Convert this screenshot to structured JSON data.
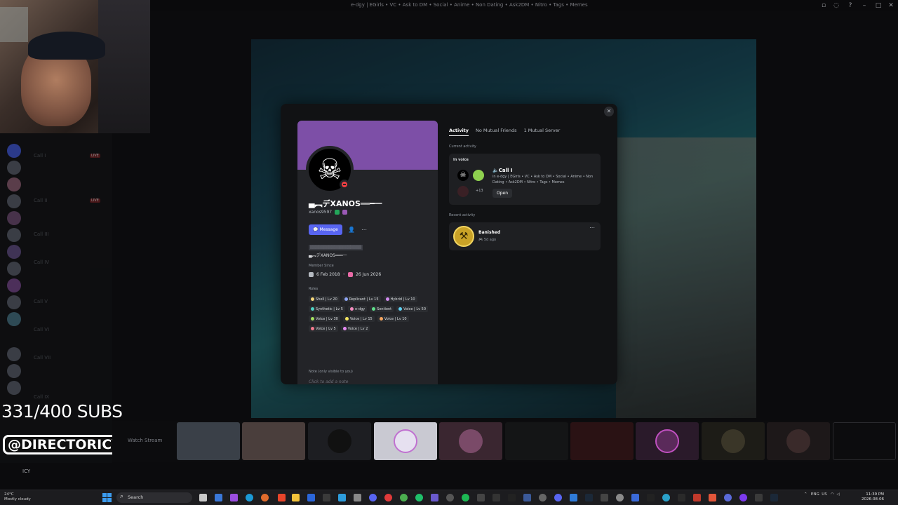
{
  "window": {
    "title": "e-dgy | EGirls • VC • Ask to DM • Social • Anime • Non Dating • Ask2DM • Nitro • Tags • Memes"
  },
  "overlay": {
    "subs_counter": "331/400 SUBS",
    "handle": "@DIRECTORICY"
  },
  "sidebar": {
    "channels": [
      {
        "label": "Call I",
        "live": "LIVE"
      },
      {
        "label": "Call II",
        "live": "LIVE"
      },
      {
        "label": "Call III",
        "live": ""
      },
      {
        "label": "Call IV",
        "live": ""
      },
      {
        "label": "Call V",
        "live": ""
      },
      {
        "label": "Call VI",
        "live": ""
      },
      {
        "label": "Call VII",
        "live": ""
      },
      {
        "label": "Call IX",
        "live": ""
      }
    ],
    "user": "ICY"
  },
  "thumbnails": {
    "watch_stream_label": "Watch Stream"
  },
  "profile": {
    "display_name": "▄︻デXANOS══━一",
    "username": "xanos9597",
    "message_label": "Message",
    "friend_icon": "add-friend-icon",
    "more_icon": "more-icon",
    "bio_name": "▄︻デXANOS══━一",
    "member_since_heading": "Member Since",
    "member_since_discord": "6 Feb 2018",
    "member_since_server": "26 Jun 2026",
    "roles_heading": "Roles",
    "roles": [
      {
        "name": "Shell | Lv 20",
        "color": "#f5d67a"
      },
      {
        "name": "Replicant | Lv 15",
        "color": "#8fa6f5"
      },
      {
        "name": "Hybrid | Lv 10",
        "color": "#d58cf2"
      },
      {
        "name": "Synthetic | Lv 5",
        "color": "#4fd3c4"
      },
      {
        "name": "e-dgy",
        "color": "#f58cc0"
      },
      {
        "name": "Sentient",
        "color": "#5fe08a"
      },
      {
        "name": "Voice | Lv 50",
        "color": "#5fd3f5"
      },
      {
        "name": "Voice | Lv 30",
        "color": "#a4e05f"
      },
      {
        "name": "Voice | Lv 15",
        "color": "#f5e65f"
      },
      {
        "name": "Voice | Lv 10",
        "color": "#f5a45f"
      },
      {
        "name": "Voice | Lv 5",
        "color": "#f57a8f"
      },
      {
        "name": "Voice | Lv 2",
        "color": "#e88cf5"
      }
    ],
    "note_heading": "Note (only visible to you)",
    "note_placeholder": "Click to add a note"
  },
  "activity": {
    "tabs": [
      "Activity",
      "No Mutual Friends",
      "1 Mutual Server"
    ],
    "current_heading": "Current activity",
    "in_voice_label": "In voice",
    "voice_count": "+13",
    "channel_name": "🔈Call I",
    "channel_desc": "in e-dgy | EGirls • VC • Ask to DM • Social • Anime • Non Dating • Ask2DM • Nitro • Tags • Memes",
    "open_label": "Open",
    "recent_heading": "Recent activity",
    "recent_title": "Banished",
    "recent_time": "🎮 5d ago"
  },
  "taskbar": {
    "temp": "24°C",
    "weather": "Mostly cloudy",
    "search": "Search",
    "lang": "ENG",
    "region": "US",
    "time": "11:39 PM",
    "date": "2026-08-06"
  },
  "colors": {
    "banner": "#7d4fa7",
    "accent": "#5865f2",
    "dnd": "#f23f43"
  }
}
